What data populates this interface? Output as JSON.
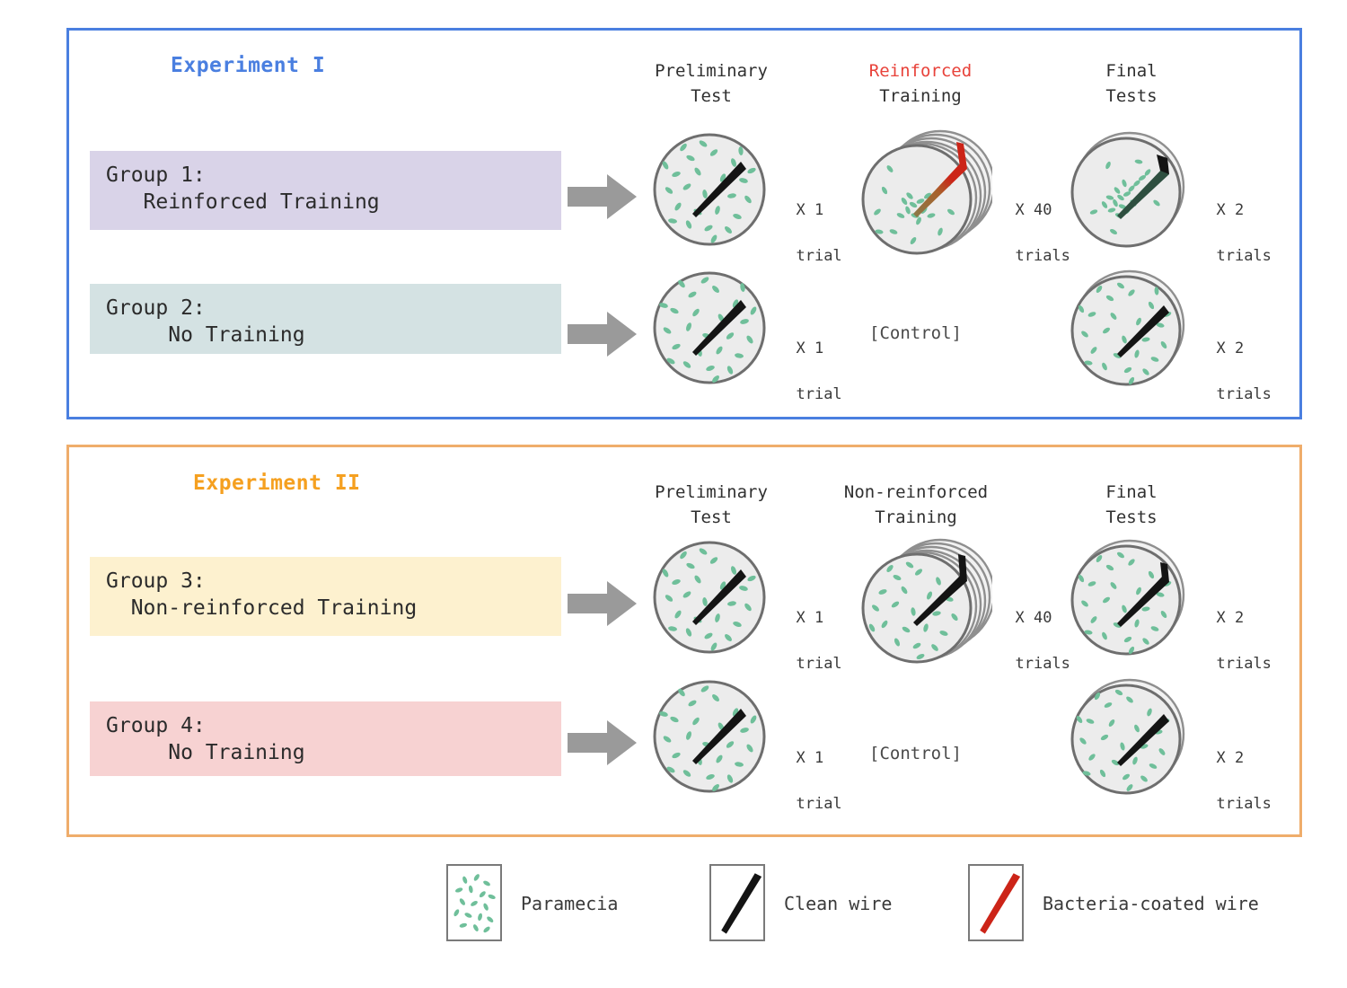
{
  "figure": {
    "kind": "experimental-design-diagram",
    "background": "#ffffff"
  },
  "experiments": [
    {
      "id": "exp1",
      "title": "Experiment I",
      "accent_color": "#4a7fe0",
      "columns": [
        {
          "line1": "Preliminary",
          "line2": "Test",
          "line1_color": "#303030"
        },
        {
          "line1": "Reinforced",
          "line2": "Training",
          "line1_color": "#e8423a"
        },
        {
          "line1": "Final",
          "line2": "Tests",
          "line1_color": "#303030"
        }
      ],
      "groups": [
        {
          "line1": "Group 1:",
          "line2": "   Reinforced Training",
          "box_color": "#d9d3e8",
          "preliminary": {
            "trial_count": "X 1",
            "trial_unit": "trial"
          },
          "training": {
            "trial_count": "X 40",
            "trial_unit": "trials",
            "control_label": null
          },
          "final": {
            "trial_count": "X 2",
            "trial_unit": "trials"
          }
        },
        {
          "line1": "Group 2:",
          "line2": "     No Training",
          "box_color": "#d4e2e3",
          "preliminary": {
            "trial_count": "X 1",
            "trial_unit": "trial"
          },
          "training": {
            "trial_count": null,
            "trial_unit": null,
            "control_label": "[Control]"
          },
          "final": {
            "trial_count": "X 2",
            "trial_unit": "trials"
          }
        }
      ]
    },
    {
      "id": "exp2",
      "title": "Experiment II",
      "accent_color": "#f5a020",
      "columns": [
        {
          "line1": "Preliminary",
          "line2": "Test",
          "line1_color": "#303030"
        },
        {
          "line1": "Non-reinforced",
          "line2": "Training",
          "line1_color": "#303030"
        },
        {
          "line1": "Final",
          "line2": "Tests",
          "line1_color": "#303030"
        }
      ],
      "groups": [
        {
          "line1": "Group 3:",
          "line2": "  Non-reinforced Training",
          "box_color": "#fdf1cf",
          "preliminary": {
            "trial_count": "X 1",
            "trial_unit": "trial"
          },
          "training": {
            "trial_count": "X 40",
            "trial_unit": "trials",
            "control_label": null
          },
          "final": {
            "trial_count": "X 2",
            "trial_unit": "trials"
          }
        },
        {
          "line1": "Group 4:",
          "line2": "     No Training",
          "box_color": "#f7d2d2",
          "preliminary": {
            "trial_count": "X 1",
            "trial_unit": "trial"
          },
          "training": {
            "trial_count": null,
            "trial_unit": null,
            "control_label": "[Control]"
          },
          "final": {
            "trial_count": "X 2",
            "trial_unit": "trials"
          }
        }
      ]
    }
  ],
  "legend": {
    "items": [
      {
        "icon": "paramecia-swatch-icon",
        "label": "Paramecia",
        "color": "#6fbf9a"
      },
      {
        "icon": "clean-wire-swatch-icon",
        "label": "Clean wire",
        "color": "#141414"
      },
      {
        "icon": "bacteria-wire-swatch-icon",
        "label": "Bacteria-coated wire",
        "color": "#cc2418"
      }
    ]
  },
  "colors": {
    "dish_fill": "#ececec",
    "dish_stroke": "#6e6e6e",
    "paramecia": "#6fbf9a",
    "clean_wire": "#141414",
    "bacteria_wire": "#cc2418",
    "arrow": "#9a9a9a",
    "exp1_frame": "#4a7fe0",
    "exp2_frame": "#efad6b"
  },
  "dish_specs": {
    "preliminary_exp1_g1": {
      "stack": 1,
      "wire": "clean",
      "paramecia": "scattered",
      "count": 34
    },
    "training_exp1_g1": {
      "stack": 6,
      "wire": "bacteria",
      "paramecia": "clustered",
      "count": 30
    },
    "final_exp1_g1": {
      "stack": 2,
      "wire": "clean",
      "paramecia": "clustered-on-wire",
      "count": 28
    },
    "preliminary_exp1_g2": {
      "stack": 1,
      "wire": "clean",
      "paramecia": "scattered",
      "count": 34
    },
    "final_exp1_g2": {
      "stack": 2,
      "wire": "clean",
      "paramecia": "scattered",
      "count": 38
    },
    "preliminary_exp2_g3": {
      "stack": 1,
      "wire": "clean",
      "paramecia": "scattered",
      "count": 34
    },
    "training_exp2_g3": {
      "stack": 6,
      "wire": "clean",
      "paramecia": "scattered",
      "count": 36
    },
    "final_exp2_g3": {
      "stack": 2,
      "wire": "clean",
      "paramecia": "scattered",
      "count": 38
    },
    "preliminary_exp2_g4": {
      "stack": 1,
      "wire": "clean",
      "paramecia": "scattered",
      "count": 34
    },
    "final_exp2_g4": {
      "stack": 2,
      "wire": "clean",
      "paramecia": "scattered",
      "count": 38
    }
  }
}
